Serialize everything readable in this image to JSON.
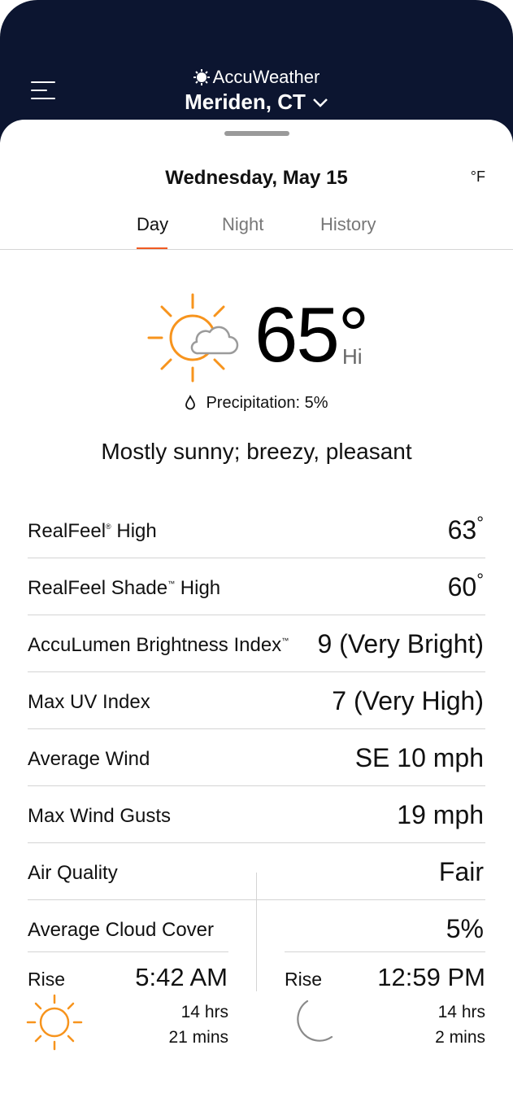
{
  "header": {
    "brand": "AccuWeather",
    "location": "Meriden, CT"
  },
  "date": "Wednesday, May 15",
  "unit": "°F",
  "tabs": [
    {
      "label": "Day",
      "active": true
    },
    {
      "label": "Night",
      "active": false
    },
    {
      "label": "History",
      "active": false
    }
  ],
  "forecast": {
    "icon": "partly-sunny-icon",
    "temperature": "65°",
    "temp_suffix": "Hi",
    "precipitation": "Precipitation: 5%",
    "phrase": "Mostly sunny; breezy, pleasant"
  },
  "details": [
    {
      "label": "RealFeel",
      "mark": "®",
      "suffix": " High",
      "value": "63",
      "deg": "°"
    },
    {
      "label": "RealFeel Shade",
      "mark": "™",
      "suffix": " High",
      "value": "60",
      "deg": "°"
    },
    {
      "label": "AccuLumen Brightness Index",
      "mark": "™",
      "suffix": "",
      "value": "9 (Very Bright)",
      "deg": ""
    },
    {
      "label": "Max UV Index",
      "mark": "",
      "suffix": "",
      "value": "7 (Very High)",
      "deg": ""
    },
    {
      "label": "Average Wind",
      "mark": "",
      "suffix": "",
      "value": "SE 10 mph",
      "deg": ""
    },
    {
      "label": "Max Wind Gusts",
      "mark": "",
      "suffix": "",
      "value": "19 mph",
      "deg": ""
    },
    {
      "label": "Air Quality",
      "mark": "",
      "suffix": "",
      "value": "Fair",
      "deg": ""
    },
    {
      "label": "Average Cloud Cover",
      "mark": "",
      "suffix": "",
      "value": "5%",
      "deg": ""
    }
  ],
  "sun": {
    "icon": "sun-icon",
    "hours": "14 hrs",
    "mins": "21 mins",
    "rise_label": "Rise",
    "rise_time": "5:42 AM"
  },
  "moon": {
    "icon": "moon-icon",
    "hours": "14 hrs",
    "mins": "2 mins",
    "rise_label": "Rise",
    "rise_time": "12:59 PM"
  },
  "colors": {
    "header_bg": "#0c1530",
    "accent": "#f05a22",
    "sun": "#f7941d"
  }
}
